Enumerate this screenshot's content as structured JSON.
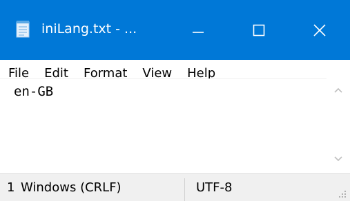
{
  "window": {
    "title": "iniLang.txt - ...",
    "accent_color": "#0078d7"
  },
  "title_buttons": {
    "minimize_icon": "minimize-icon",
    "maximize_icon": "maximize-icon",
    "close_icon": "close-icon"
  },
  "menu": {
    "items": [
      {
        "label": "File"
      },
      {
        "label": "Edit"
      },
      {
        "label": "Format"
      },
      {
        "label": "View"
      },
      {
        "label": "Help"
      }
    ]
  },
  "editor": {
    "content": "en-GB"
  },
  "statusbar": {
    "position": "1",
    "line_ending": "Windows (CRLF)",
    "encoding": "UTF-8"
  }
}
